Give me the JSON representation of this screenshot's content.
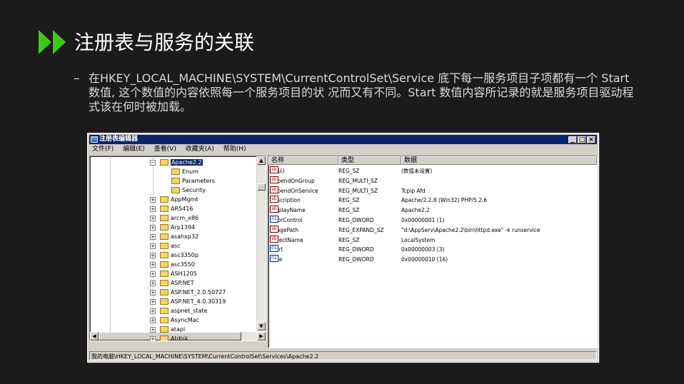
{
  "slide": {
    "title": "注册表与服务的关联",
    "bullet_dash": "–",
    "bullet": "在HKEY_LOCAL_MACHINE\\SYSTEM\\CurrentControlSet\\Service 底下每一服务项目子项都有一个 Start 数值, 这个数值的内容依照每一个服务项目的状 况而又有不同。Start 数值内容所记录的就是服务项目驱动程式该在何时被加载。",
    "accent": "#3ec81e"
  },
  "window": {
    "title": "注册表编辑器",
    "buttons": [
      "_",
      "□",
      "×"
    ],
    "menu": [
      "文件(F)",
      "编辑(E)",
      "查看(V)",
      "收藏夹(A)",
      "帮助(H)"
    ],
    "status": "我的电脑\\HKEY_LOCAL_MACHINE\\SYSTEM\\CurrentControlSet\\Services\\Apache2.2"
  },
  "tree": {
    "selected": "Apache2.2",
    "children": [
      "Enum",
      "Parameters",
      "Security"
    ],
    "siblings": [
      "AppMgmt",
      "AR5416",
      "arcm_x86",
      "Arp1394",
      "asahxp32",
      "asc",
      "asc3350p",
      "asc3550",
      "ASH1205",
      "ASP.NET",
      "ASP.NET_2.0.50727",
      "ASP.NET_4.0.30319",
      "aspnet_state",
      "AsyncMac",
      "atapi",
      "Atdisk"
    ]
  },
  "list": {
    "columns": [
      "名称",
      "类型",
      "数据"
    ],
    "rows": [
      {
        "icon": "ab",
        "name": "(默认)",
        "type": "REG_SZ",
        "data": "(数值未设置)"
      },
      {
        "icon": "ab",
        "name": "DependOnGroup",
        "type": "REG_MULTI_SZ",
        "data": ""
      },
      {
        "icon": "ab",
        "name": "DependOnService",
        "type": "REG_MULTI_SZ",
        "data": "Tcpip Afd"
      },
      {
        "icon": "ab",
        "name": "Description",
        "type": "REG_SZ",
        "data": "Apache/2.2.8 (Win32) PHP/5.2.6"
      },
      {
        "icon": "ab",
        "name": "DisplayName",
        "type": "REG_SZ",
        "data": "Apache2.2"
      },
      {
        "icon": "bin",
        "name": "ErrorControl",
        "type": "REG_DWORD",
        "data": "0x00000001 (1)"
      },
      {
        "icon": "ab",
        "name": "ImagePath",
        "type": "REG_EXPAND_SZ",
        "data": "\"d:\\AppServ\\Apache2.2\\bin\\httpd.exe\" -k runservice"
      },
      {
        "icon": "ab",
        "name": "ObjectName",
        "type": "REG_SZ",
        "data": "LocalSystem"
      },
      {
        "icon": "bin",
        "name": "Start",
        "type": "REG_DWORD",
        "data": "0x00000003 (3)"
      },
      {
        "icon": "bin",
        "name": "Type",
        "type": "REG_DWORD",
        "data": "0x00000010 (16)"
      }
    ]
  }
}
